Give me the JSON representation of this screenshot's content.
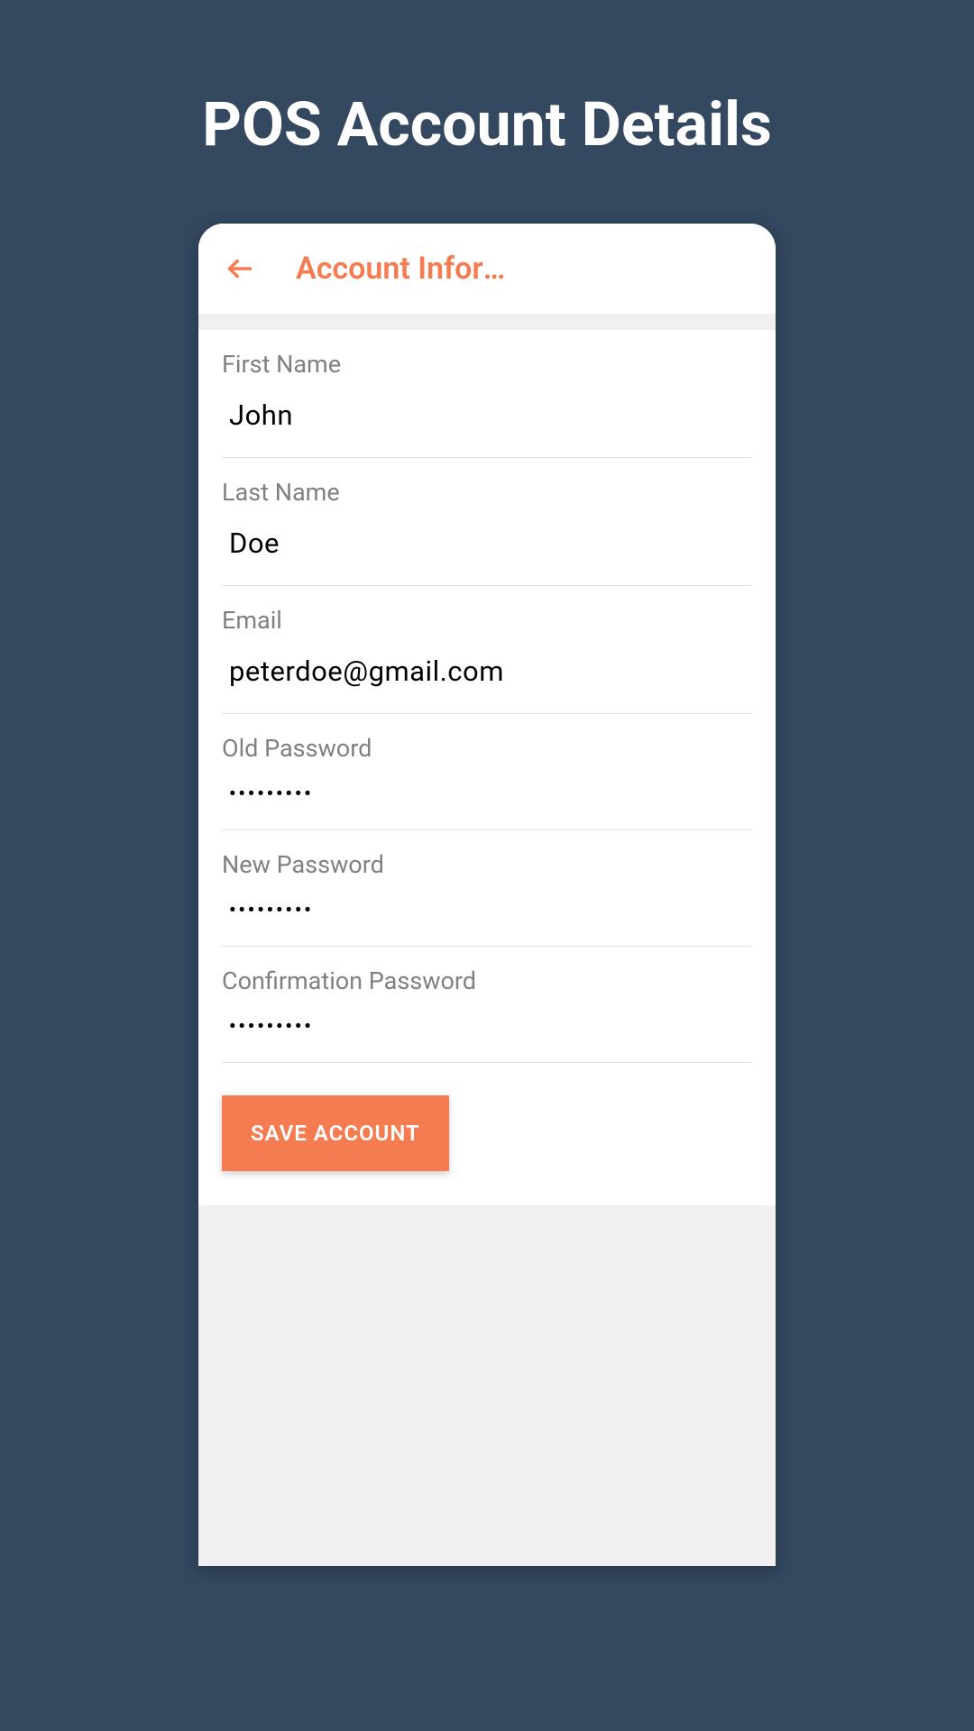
{
  "page": {
    "title": "POS Account Details"
  },
  "header": {
    "title": "Account Informat…"
  },
  "form": {
    "firstName": {
      "label": "First Name",
      "value": "John"
    },
    "lastName": {
      "label": "Last Name",
      "value": "Doe"
    },
    "email": {
      "label": "Email",
      "value": "peterdoe@gmail.com"
    },
    "oldPassword": {
      "label": "Old Password",
      "value": "•••••••••"
    },
    "newPassword": {
      "label": "New Password",
      "value": "•••••••••"
    },
    "confirmPassword": {
      "label": "Confirmation Password",
      "value": "•••••••••"
    },
    "saveButton": "SAVE ACCOUNT"
  }
}
